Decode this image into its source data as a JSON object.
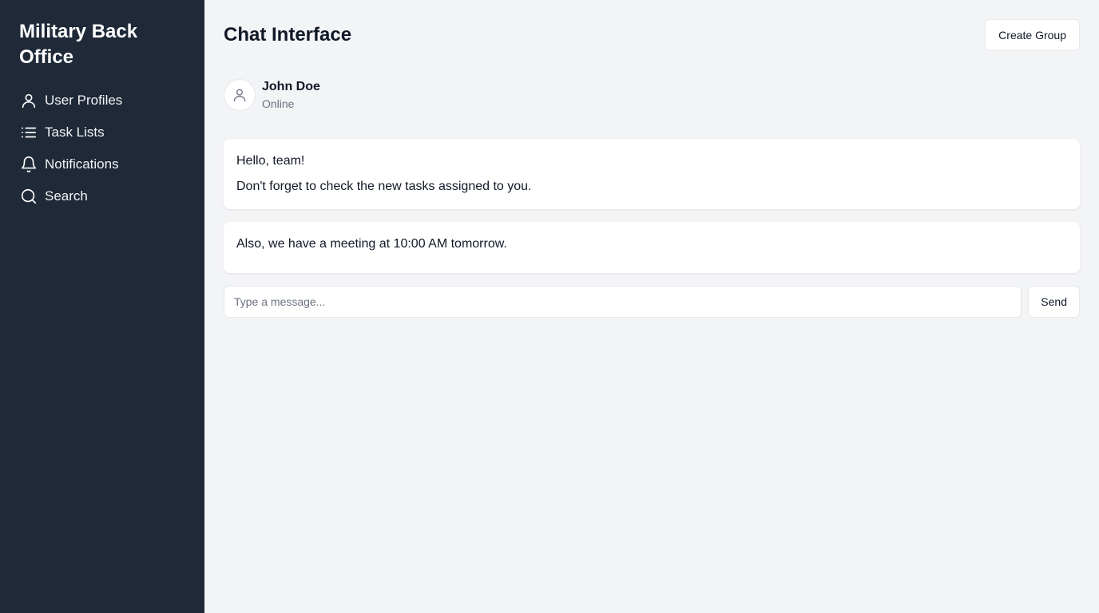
{
  "sidebar": {
    "title": "Military Back Office",
    "items": [
      {
        "label": "User Profiles",
        "icon": "user-icon"
      },
      {
        "label": "Task Lists",
        "icon": "list-icon"
      },
      {
        "label": "Notifications",
        "icon": "bell-icon"
      },
      {
        "label": "Search",
        "icon": "search-icon"
      }
    ]
  },
  "header": {
    "title": "Chat Interface",
    "create_group_label": "Create Group"
  },
  "contact": {
    "name": "John Doe",
    "status": "Online",
    "avatar_icon": "user-icon"
  },
  "messages": [
    {
      "lines": [
        "Hello, team!",
        "Don't forget to check the new tasks assigned to you."
      ]
    },
    {
      "lines": [
        "Also, we have a meeting at 10:00 AM tomorrow."
      ]
    }
  ],
  "composer": {
    "placeholder": "Type a message...",
    "value": "",
    "send_label": "Send"
  },
  "colors": {
    "sidebar_bg": "#1f2937",
    "page_bg": "#f3f4f6",
    "card_bg": "#ffffff"
  }
}
